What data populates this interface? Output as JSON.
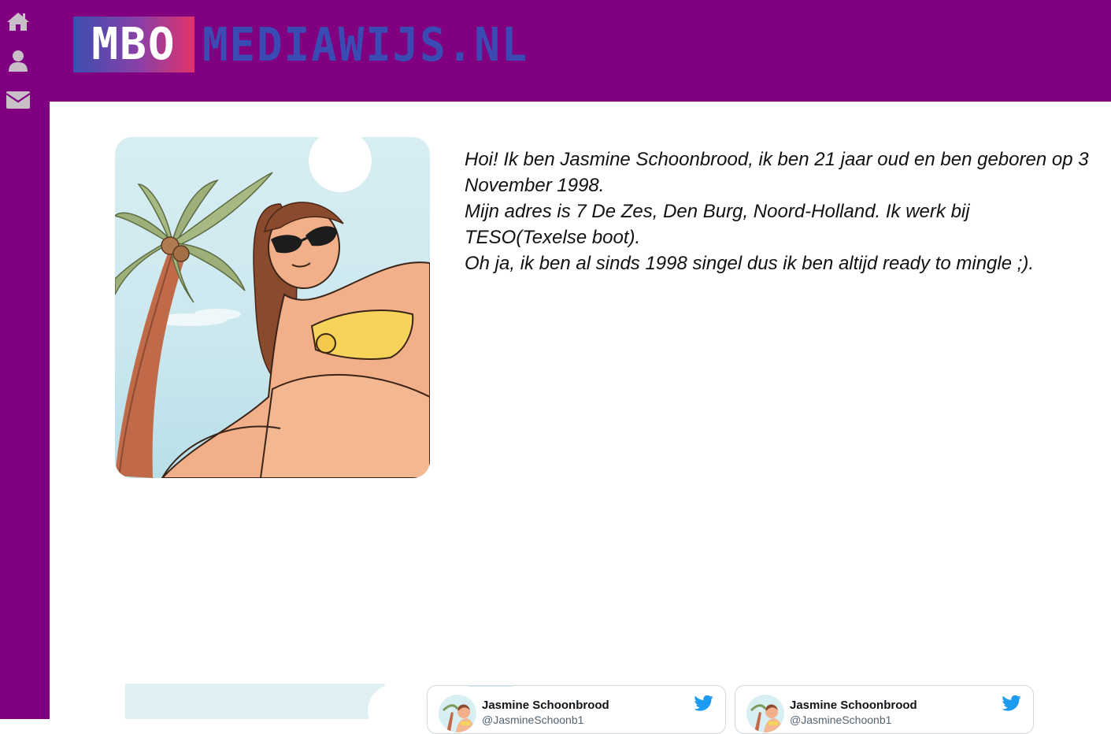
{
  "sidebar": {
    "items": [
      {
        "icon": "home-icon"
      },
      {
        "icon": "user-icon"
      },
      {
        "icon": "envelope-icon"
      }
    ],
    "icon_color": "#c9bfc9"
  },
  "header": {
    "logo_mbo": "MBO",
    "logo_site": "MEDIAWIJS.NL",
    "background": "#800080"
  },
  "profile": {
    "paragraphs": [
      "Hoi! Ik ben Jasmine Schoonbrood, ik ben 21 jaar oud en ben geboren op 3 November 1998.",
      "Mijn adres is 7 De Zes, Den Burg, Noord-Holland. Ik werk bij TESO(Texelse boot).",
      "Oh ja, ik ben al sinds 1998 singel dus ik ben altijd ready to mingle ;)."
    ]
  },
  "tweets": [
    {
      "name": "Jasmine Schoonbrood",
      "handle": "@JasmineSchoonb1"
    },
    {
      "name": "Jasmine Schoonbrood",
      "handle": "@JasmineSchoonb1"
    }
  ],
  "colors": {
    "accent": "#800080",
    "logo_blue": "#3a4cb3",
    "twitter_blue": "#1d9bf0"
  }
}
